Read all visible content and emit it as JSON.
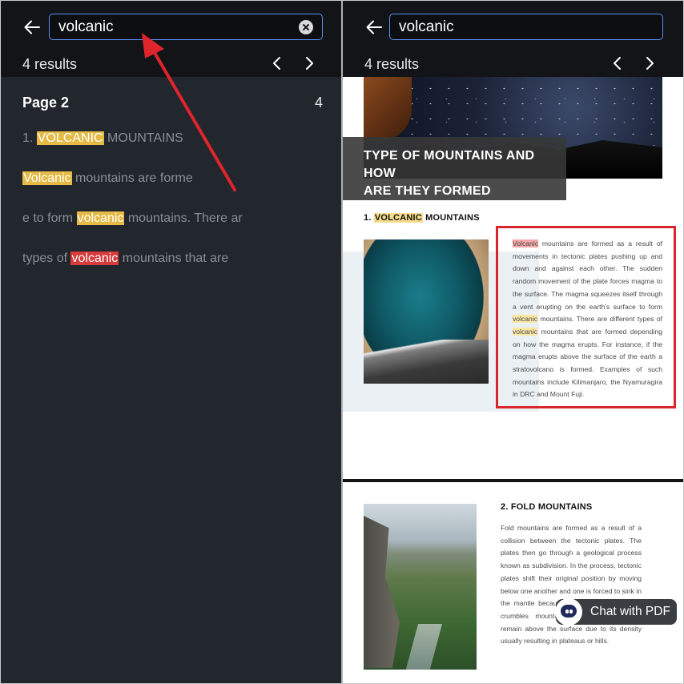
{
  "search": {
    "query": "volcanic",
    "results_label": "4 results"
  },
  "colors": {
    "highlight": "#e5bb46",
    "active_highlight": "#d63a3a",
    "search_border": "#5b8ff0",
    "annotation_red": "#d8262d"
  },
  "icons": {
    "back": "arrow-left-icon",
    "clear": "clear-icon",
    "prev": "chevron-left-icon",
    "next": "chevron-right-icon",
    "chat": "chat-bot-icon"
  },
  "left_panel": {
    "page_label": "Page 2",
    "page_count": "4",
    "snippets": [
      {
        "before": "1. ",
        "match": "VOLCANIC",
        "after": " MOUNTAINS",
        "active": false
      },
      {
        "before": "",
        "match": "Volcanic",
        "after": " mountains are forme",
        "active": false
      },
      {
        "before": "e to form ",
        "match": "volcanic",
        "after": " mountains. There ar",
        "active": false
      },
      {
        "before": "types of ",
        "match": "volcanic",
        "after": " mountains that are",
        "active": true
      }
    ]
  },
  "document": {
    "hero_title_line1": "TYPE OF MOUNTAINS AND HOW",
    "hero_title_line2": "ARE THEY FORMED",
    "section1": {
      "number": "1. ",
      "match": "VOLCANIC",
      "rest": " MOUNTAINS",
      "body": [
        {
          "t": "Volcanic",
          "h": "active"
        },
        {
          "t": " mountains are formed as a result of movements in tectonic plates pushing up and down and against each other. The sudden random movement of the plate forces magma to the surface. The magma squeezes itself through a vent erupting on the earth's surface to form ",
          "h": ""
        },
        {
          "t": "volcanic",
          "h": "match"
        },
        {
          "t": " mountains. There are different types of ",
          "h": ""
        },
        {
          "t": "volcanic",
          "h": "match"
        },
        {
          "t": " mountains that are formed depending on how the magma erupts. For instance, if the magma erupts above the surface of the earth a stratovolcano is formed. Examples of such mountains include Kilimanjaro, the Nyamuragira in DRC and Mount Fuji.",
          "h": ""
        }
      ]
    },
    "section2": {
      "title": "2. FOLD MOUNTAINS",
      "body": "Fold mountains are formed as a result of a collision between the tectonic plates. The plates then go through a geological process known as subdivision. In the process, tectonic plates shift their original position by moving below one another and one is forced to sink in the mantle because of gravity. W the plate crumbles mountain. The other materials remain above the surface due to its density usually resulting in plateaus or hills."
    }
  },
  "chat_button": {
    "label": "Chat with PDF"
  }
}
